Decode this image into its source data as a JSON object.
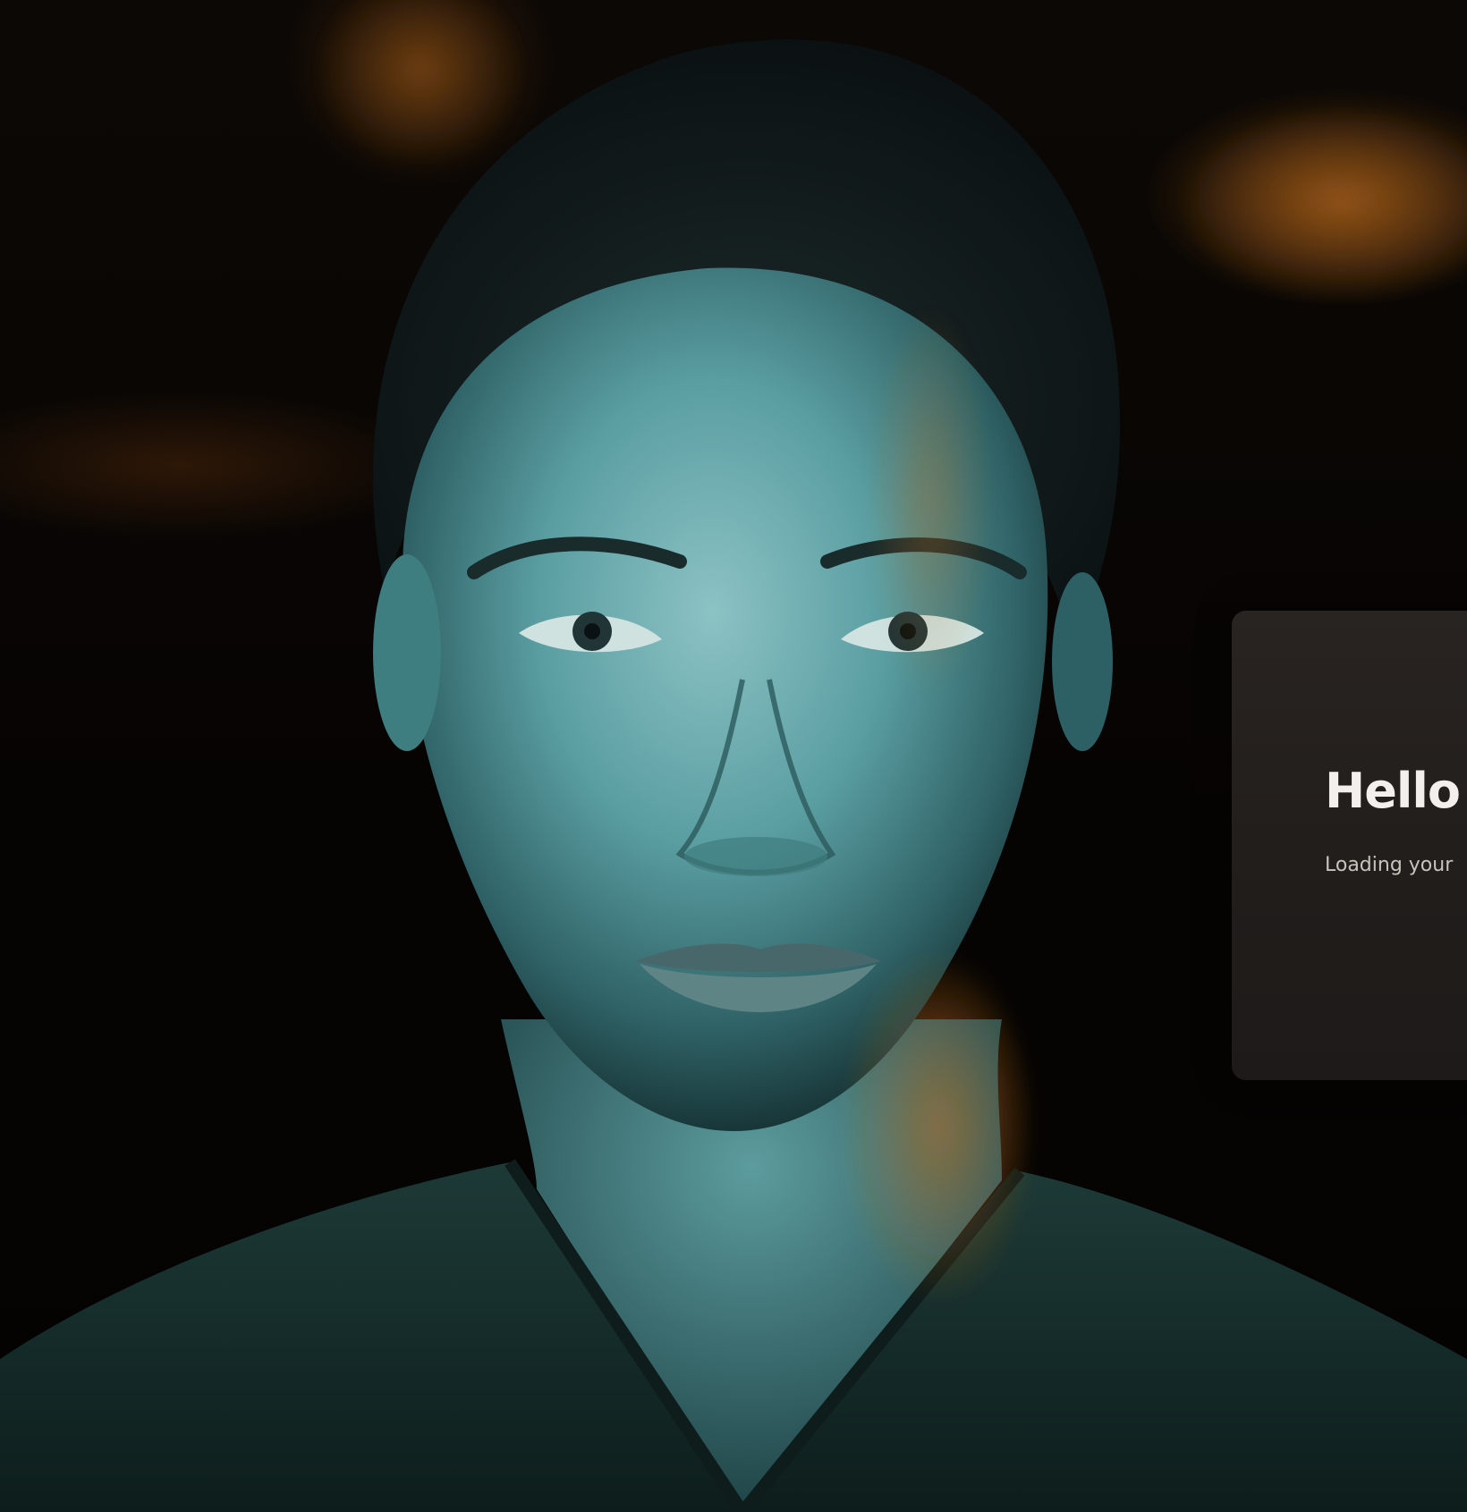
{
  "welcome": {
    "title": "Hello",
    "subtitle": "Loading your"
  },
  "background": {
    "image_subject": "portrait-of-woman",
    "accent_color": "#8a4a14",
    "tint_color": "#5fa3a6"
  },
  "colors": {
    "card_bg": "#2a2522",
    "title_text": "#f2efec",
    "subtitle_text": "#c9c3bd"
  }
}
